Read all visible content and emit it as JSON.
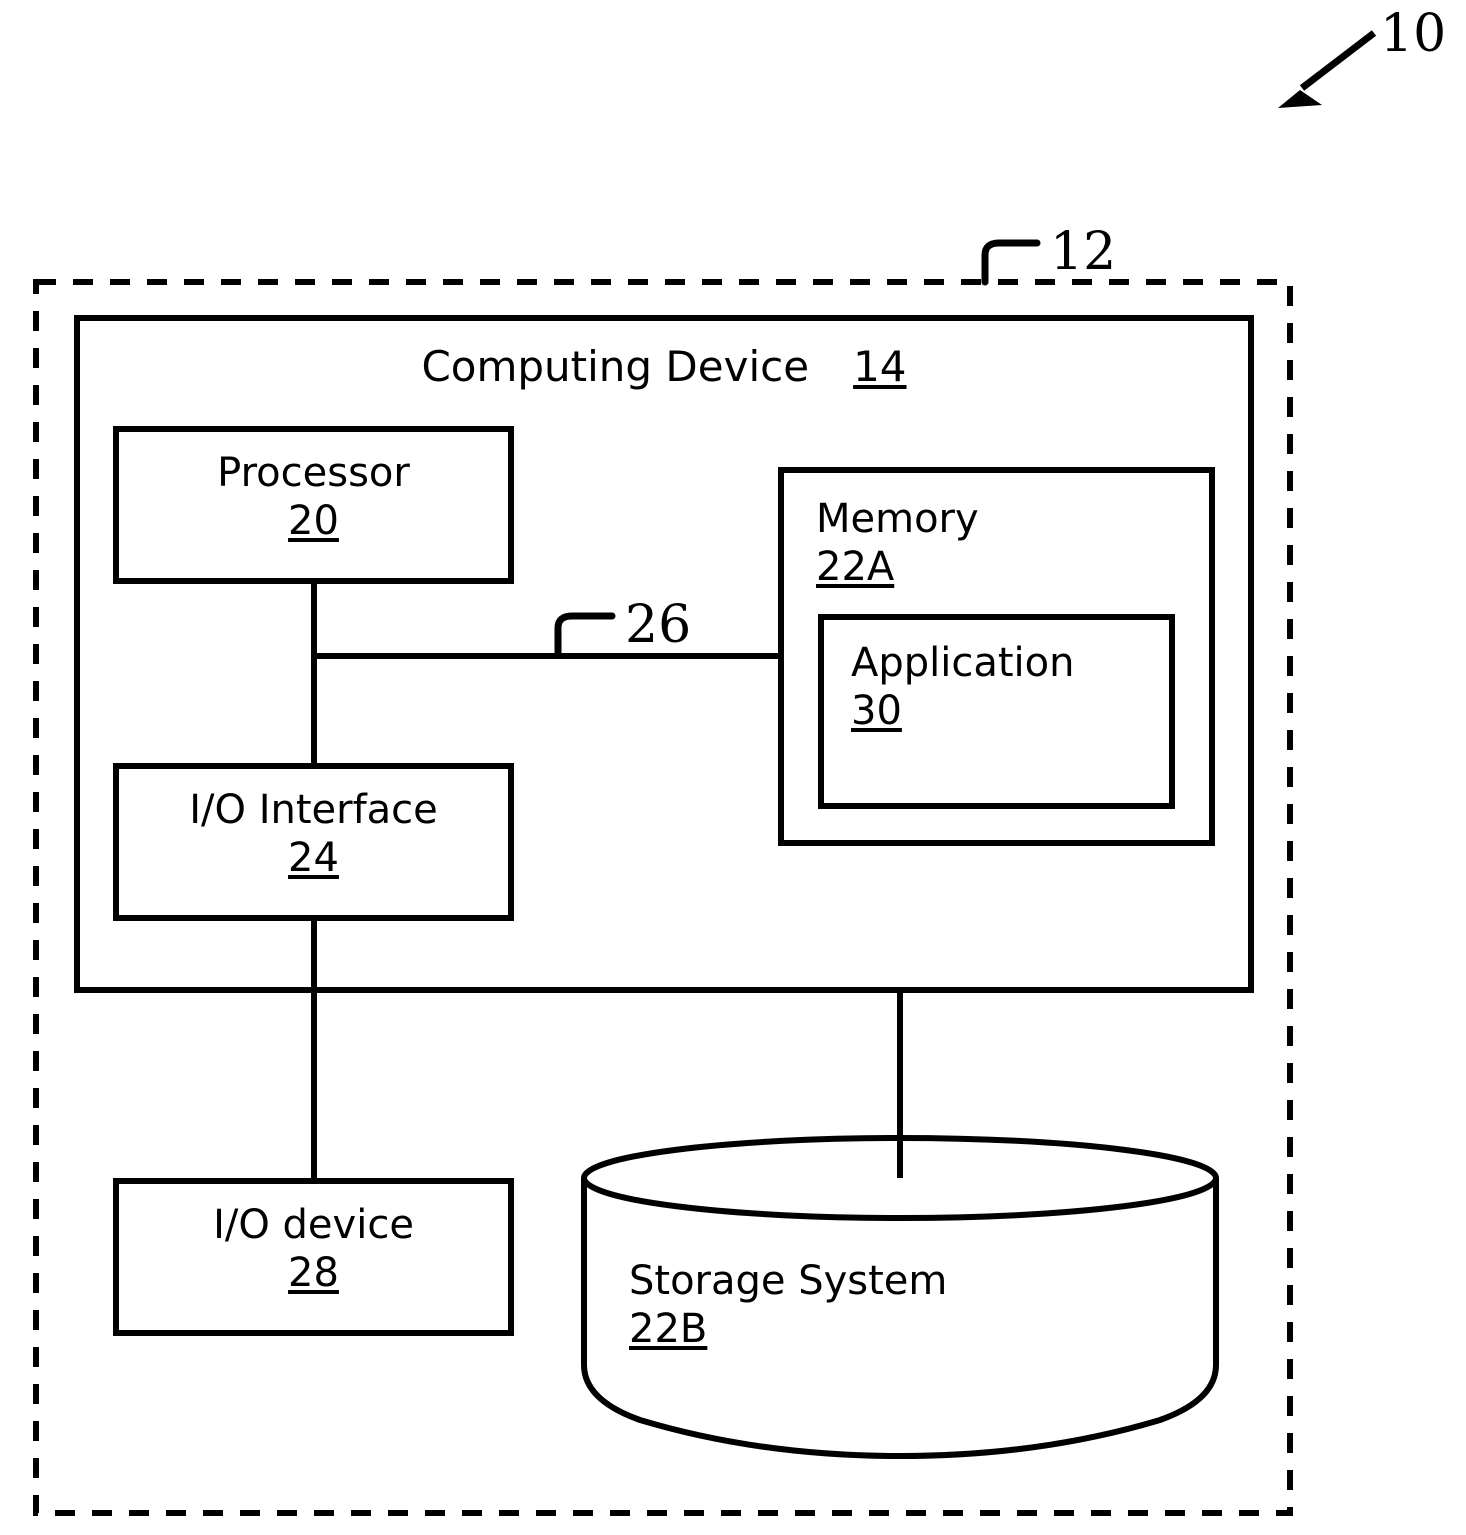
{
  "figure": {
    "type": "patent-block-diagram",
    "background_color": "#ffffff",
    "line_color": "#000000"
  },
  "callouts": {
    "system": "10",
    "environment": "12",
    "bus": "26"
  },
  "outer_boundary": {
    "name": "computer-system-environment",
    "style": "dashed",
    "ref": "12"
  },
  "computing_device": {
    "label": "Computing Device",
    "ref": "14"
  },
  "processor": {
    "label": "Processor",
    "ref": "20"
  },
  "io_interface": {
    "label": "I/O Interface",
    "ref": "24"
  },
  "io_device": {
    "label": "I/O device",
    "ref": "28"
  },
  "memory": {
    "label": "Memory",
    "ref": "22A"
  },
  "application": {
    "label": "Application",
    "ref": "30"
  },
  "storage_system": {
    "label": "Storage System",
    "ref": "22B"
  },
  "bus": {
    "ref": "26"
  }
}
